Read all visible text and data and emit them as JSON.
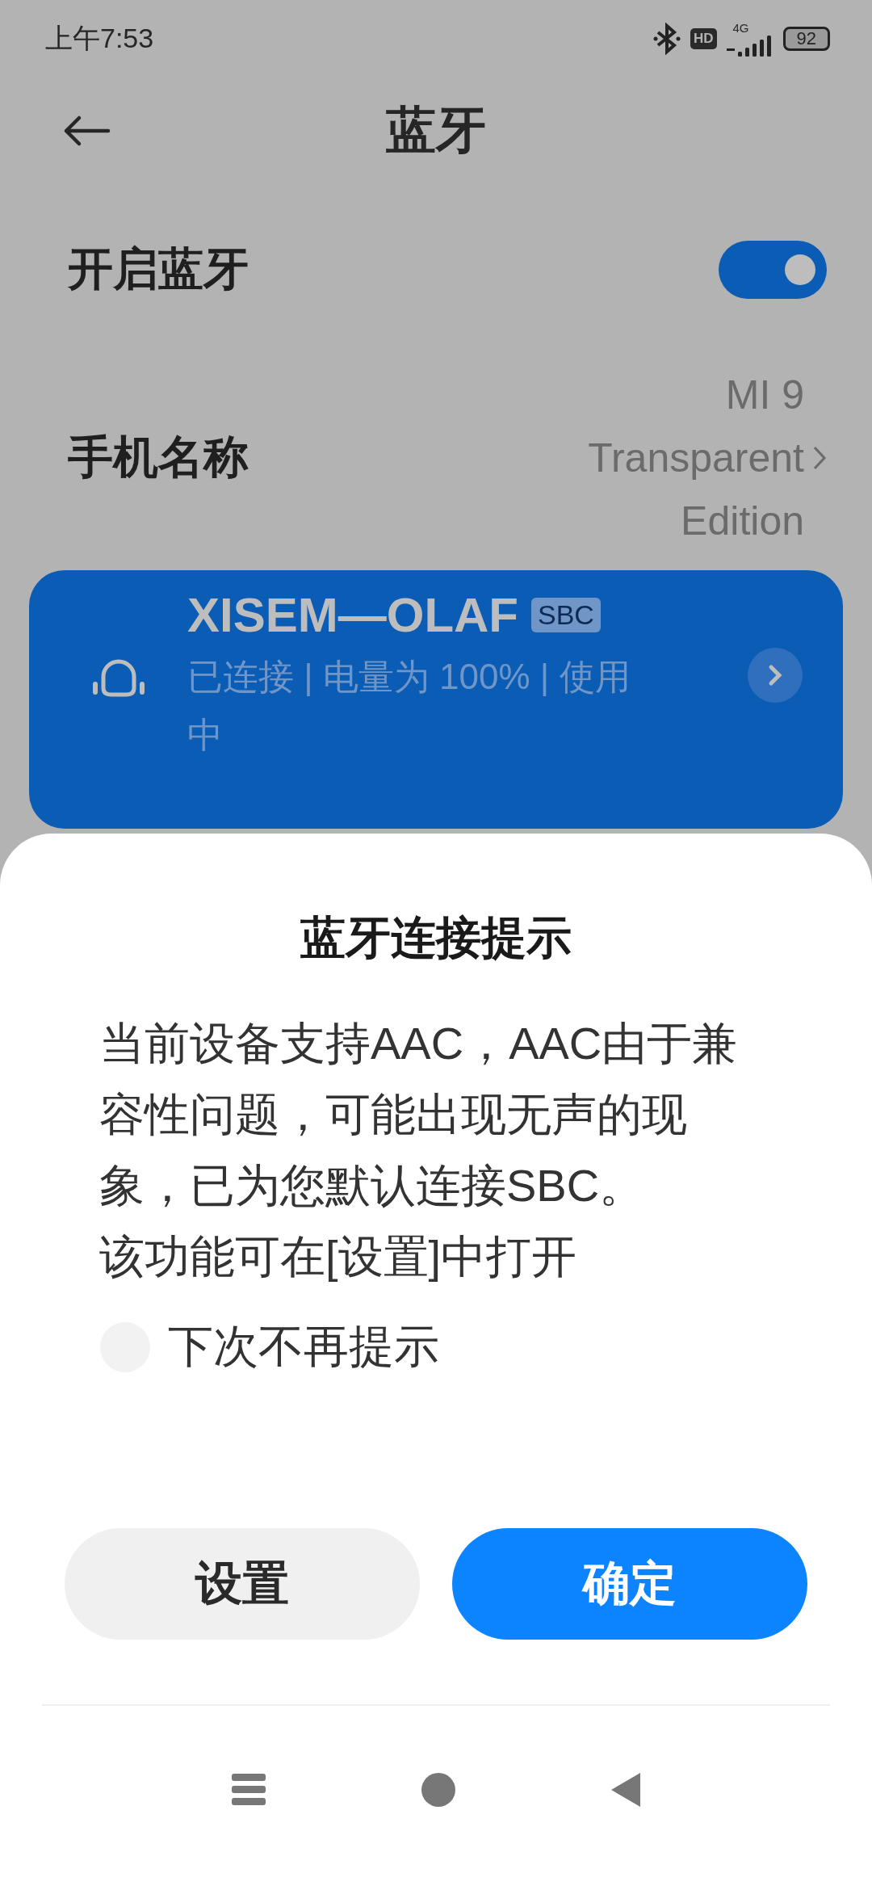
{
  "status_bar": {
    "time": "上午7:53",
    "hd_badge": "HD",
    "network": "4G",
    "battery": "92"
  },
  "header": {
    "title": "蓝牙"
  },
  "bluetooth_switch": {
    "label": "开启蓝牙",
    "on": true
  },
  "phone_name": {
    "label": "手机名称",
    "value": "MI 9 Transparent Edition"
  },
  "device": {
    "name": "XISEM—OLAF",
    "codec": "SBC",
    "status": "已连接 | 电量为 100% | 使用中"
  },
  "dialog": {
    "title": "蓝牙连接提示",
    "paragraphs": [
      "当前设备支持AAC，AAC由于兼容性问题，可能出现无声的现象，已为您默认连接SBC。",
      "该功能可在[设置]中打开"
    ],
    "checkbox": {
      "label": "下次不再提示",
      "checked": false
    },
    "buttons": [
      {
        "label": "设置",
        "kind": "secondary"
      },
      {
        "label": "确定",
        "kind": "primary"
      }
    ]
  }
}
